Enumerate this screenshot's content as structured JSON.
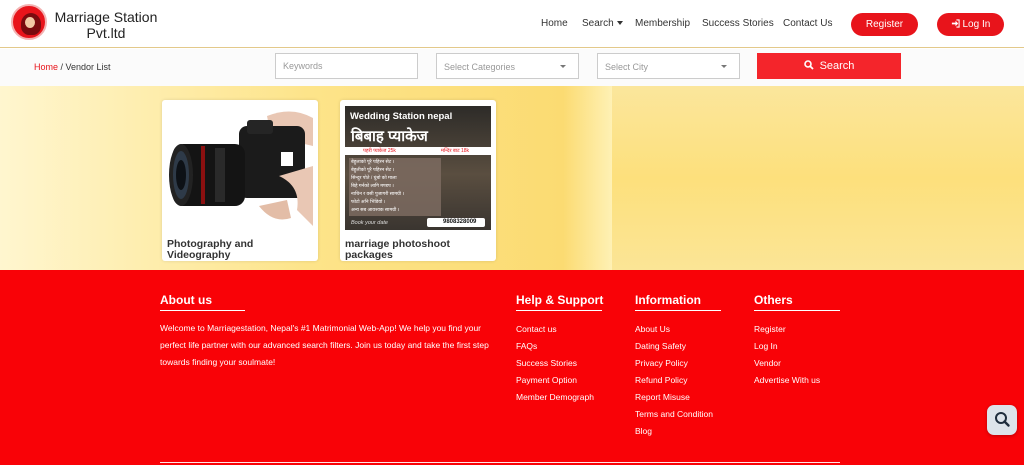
{
  "brand": {
    "name_line1": "Marriage Station",
    "name_line2": "Pvt.ltd"
  },
  "nav": {
    "home": "Home",
    "search": "Search",
    "membership": "Membership",
    "success": "Success Stories",
    "contact": "Contact Us",
    "register": "Register",
    "login": "Log In"
  },
  "breadcrumb": {
    "home": "Home",
    "sep": " / ",
    "current": "Vendor List"
  },
  "search": {
    "keywords_placeholder": "Keywords",
    "categories_placeholder": "Select Categories",
    "city_placeholder": "Select City",
    "button": "Search"
  },
  "vendors": [
    {
      "title": "Photography and Videography"
    },
    {
      "title": "marriage photoshoot packages",
      "poster": {
        "brand": "Wedding Station nepal",
        "headline": "बिबाह प्याकेज",
        "price_left": "पहरी प्याकेज 25k",
        "price_right": "मन्दिर बाट 18k",
        "lines": [
          "बेहुलाको पूरै पहिरन सेट ।",
          "बेहुलीको पूरै पहिरन सेट ।",
          "सिन्दुर पोते / धुंबो को माला",
          "बिहे गर्नको लागि मण्डप ।",
          "नाचिन र वसी पुजागरी सामग्री ।",
          "फोटो अनि भिडियो ।",
          "अन्य सब आवश्यक सामग्री ।"
        ],
        "cta": "Book your date",
        "phone": "9808328009"
      }
    }
  ],
  "footer": {
    "about": {
      "title": "About us",
      "text": "Welcome to Marriagestation, Nepal's #1 Matrimonial Web-App! We help you find your perfect life partner with our advanced search filters. Join us today and take the first step towards finding your soulmate!"
    },
    "help": {
      "title": "Help & Support",
      "links": [
        "Contact us",
        "FAQs",
        "Success Stories",
        "Payment Option",
        "Member Demograph"
      ]
    },
    "info": {
      "title": "Information",
      "links": [
        "About Us",
        "Dating Safety",
        "Privacy Policy",
        "Refund Policy",
        "Report Misuse",
        "Terms and Condition",
        "Blog"
      ]
    },
    "others": {
      "title": "Others",
      "links": [
        "Register",
        "Log In",
        "Vendor",
        "Advertise With us"
      ]
    }
  },
  "colors": {
    "accent": "#e8141b",
    "footer": "#f90207",
    "band": "#fbdb72"
  },
  "icons": {
    "search": "search-icon",
    "login": "sign-in-icon",
    "fab": "search-icon"
  }
}
